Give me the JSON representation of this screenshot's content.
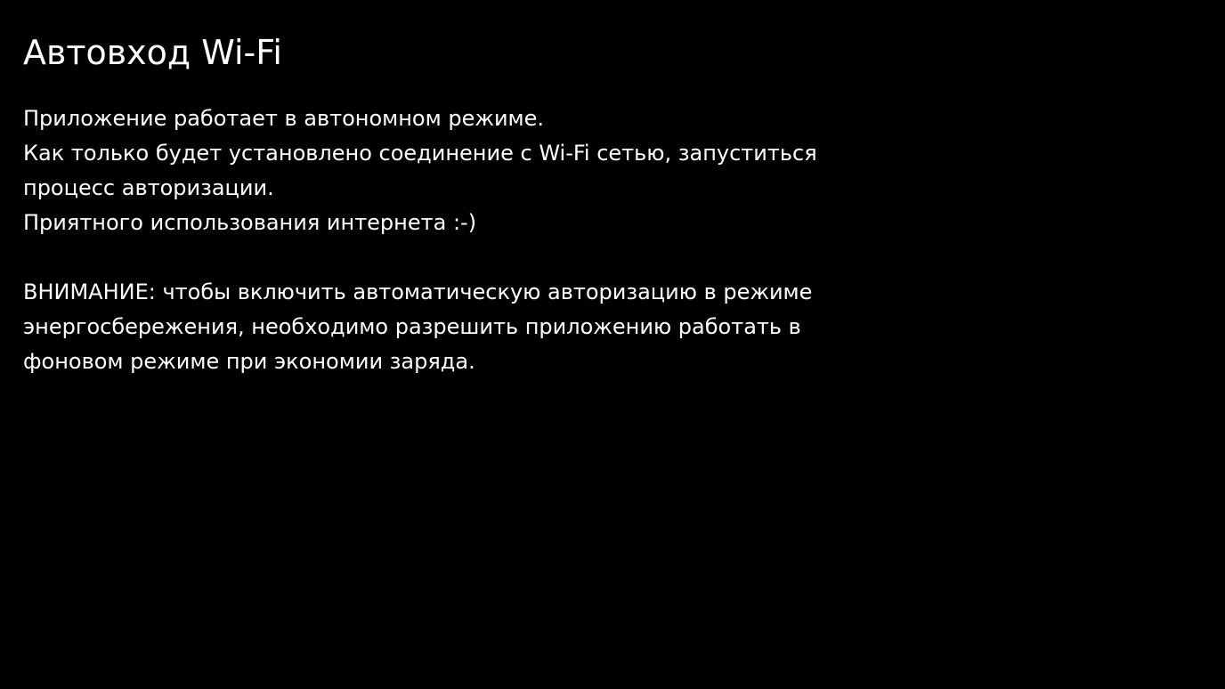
{
  "colors": {
    "background": "#000000",
    "text": "#ffffff"
  },
  "page": {
    "title": "Автовход Wi-Fi"
  },
  "info": {
    "lines": [
      "Приложение работает в автономном режиме.",
      "Как только будет установлено соединение с Wi-Fi сетью, запуститься",
      "процесс авторизации.",
      "Приятного использования интернета :-)"
    ]
  },
  "warning": {
    "lines": [
      "ВНИМАНИЕ: чтобы включить автоматическую авторизацию в режиме",
      "энергосбережения, необходимо разрешить приложению работать в",
      "фоновом режиме при экономии заряда."
    ]
  }
}
